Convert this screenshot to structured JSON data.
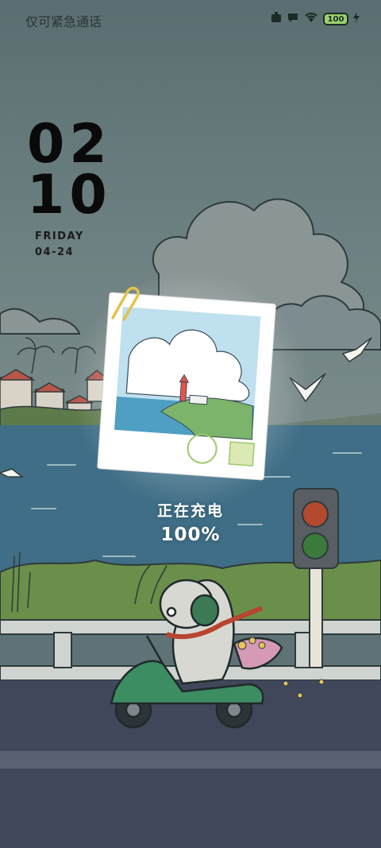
{
  "status_bar": {
    "left_text": "仅可紧急通话",
    "icons": [
      "notification-app-icon",
      "message-icon",
      "wifi-icon",
      "battery-icon",
      "charging-bolt-icon"
    ],
    "battery_level": "100"
  },
  "clock": {
    "hours": "02",
    "minutes": "10",
    "weekday": "FRIDAY",
    "date": "04-24"
  },
  "charging": {
    "label": "正在充电",
    "percent": "100%"
  },
  "colors": {
    "sky": "#5f7377",
    "sea": "#3c6c85",
    "road": "#3f4654",
    "scooter": "#2f8a5a",
    "text_primary": "#0a0a0a",
    "text_light": "#ffffff"
  }
}
